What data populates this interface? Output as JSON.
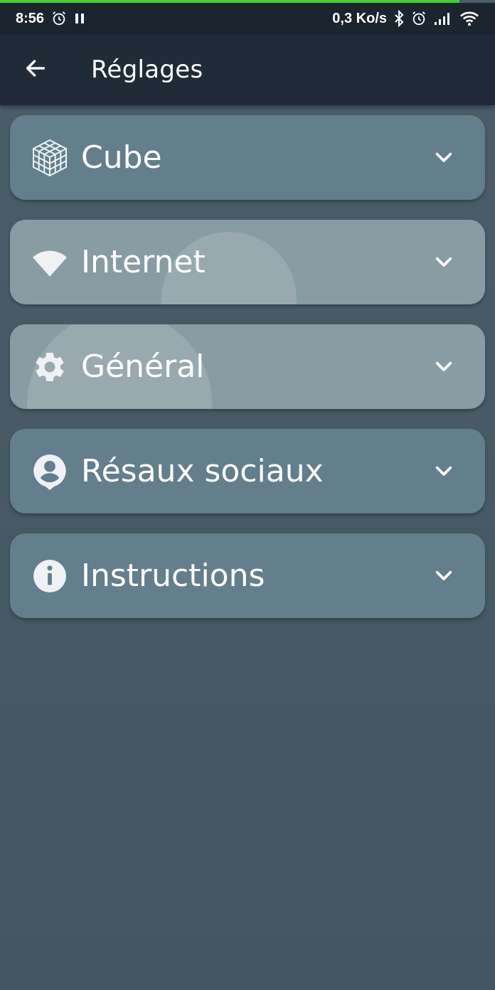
{
  "status_bar": {
    "time": "8:56",
    "network_speed": "0,3 Ko/s",
    "icons_left": [
      "alarm-icon",
      "pause-icon"
    ],
    "icons_right": [
      "bluetooth-icon",
      "alarm-icon",
      "signal-icon",
      "wifi-icon"
    ]
  },
  "app_bar": {
    "title": "Réglages",
    "back_icon": "arrow-left-icon"
  },
  "sections": [
    {
      "label": "Cube",
      "icon": "cube-icon",
      "expanded": false
    },
    {
      "label": "Internet",
      "icon": "wifi-icon",
      "expanded": false
    },
    {
      "label": "Général",
      "icon": "gear-icon",
      "expanded": false
    },
    {
      "label": "Résaux sociaux",
      "icon": "account-icon",
      "expanded": false
    },
    {
      "label": "Instructions",
      "icon": "info-icon",
      "expanded": false
    }
  ],
  "colors": {
    "background": "#475a65",
    "card": "#637e8c",
    "card_pressed": "#889ca4",
    "app_bar": "#1f2c38",
    "status_bar": "#1b2530",
    "progress": "#39d62d"
  }
}
